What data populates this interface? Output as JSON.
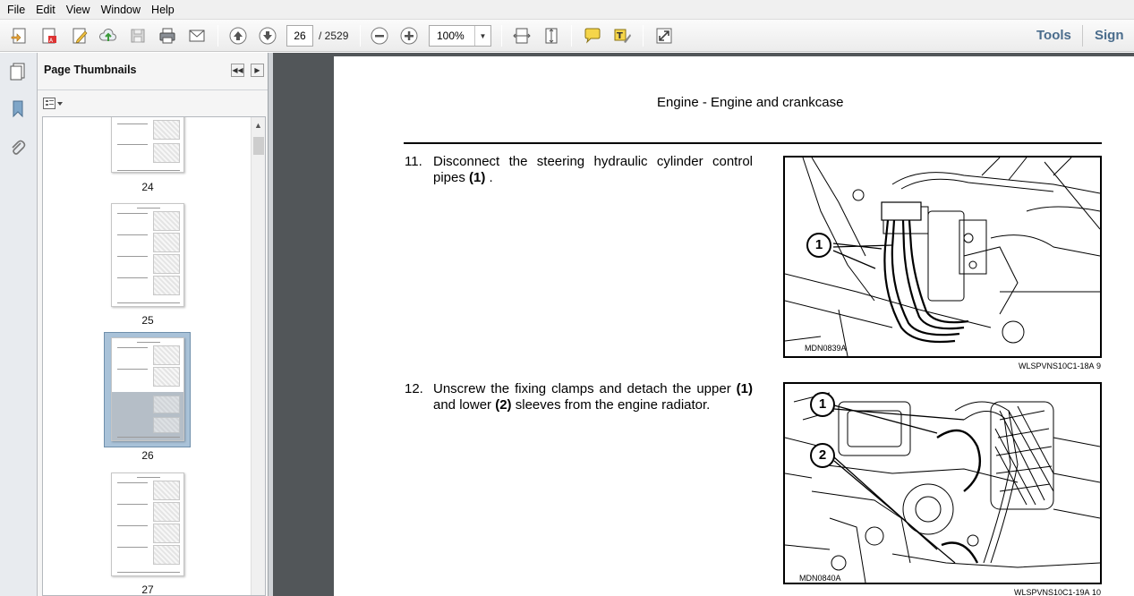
{
  "menu": [
    "File",
    "Edit",
    "View",
    "Window",
    "Help"
  ],
  "toolbar": {
    "current_page": "26",
    "page_total": "/  2529",
    "zoom": "100%",
    "tools_label": "Tools",
    "sign_label": "Sign"
  },
  "sidebar": {
    "title": "Page Thumbnails",
    "thumbnails": [
      {
        "label": "24"
      },
      {
        "label": "25"
      },
      {
        "label": "26",
        "selected": true
      },
      {
        "label": "27"
      }
    ]
  },
  "document": {
    "header": "Engine - Engine and crankcase",
    "steps": [
      {
        "number": "11.",
        "text_before": "Disconnect the steering hydraulic cylinder control pipes ",
        "bold1": "(1)",
        "text_after": " .",
        "figure_code": "MDN0839A",
        "figure_ref": "WLSPVNS10C1-18A",
        "figure_num": "9",
        "callouts": [
          "1"
        ]
      },
      {
        "number": "12.",
        "text_before": "Unscrew the fixing clamps and detach the upper ",
        "bold1": "(1)",
        "text_mid": " and lower ",
        "bold2": "(2)",
        "text_after": " sleeves from the engine radiator.",
        "figure_code": "MDN0840A",
        "figure_ref": "WLSPVNS10C1-19A",
        "figure_num": "10",
        "callouts": [
          "1",
          "2"
        ]
      }
    ]
  }
}
